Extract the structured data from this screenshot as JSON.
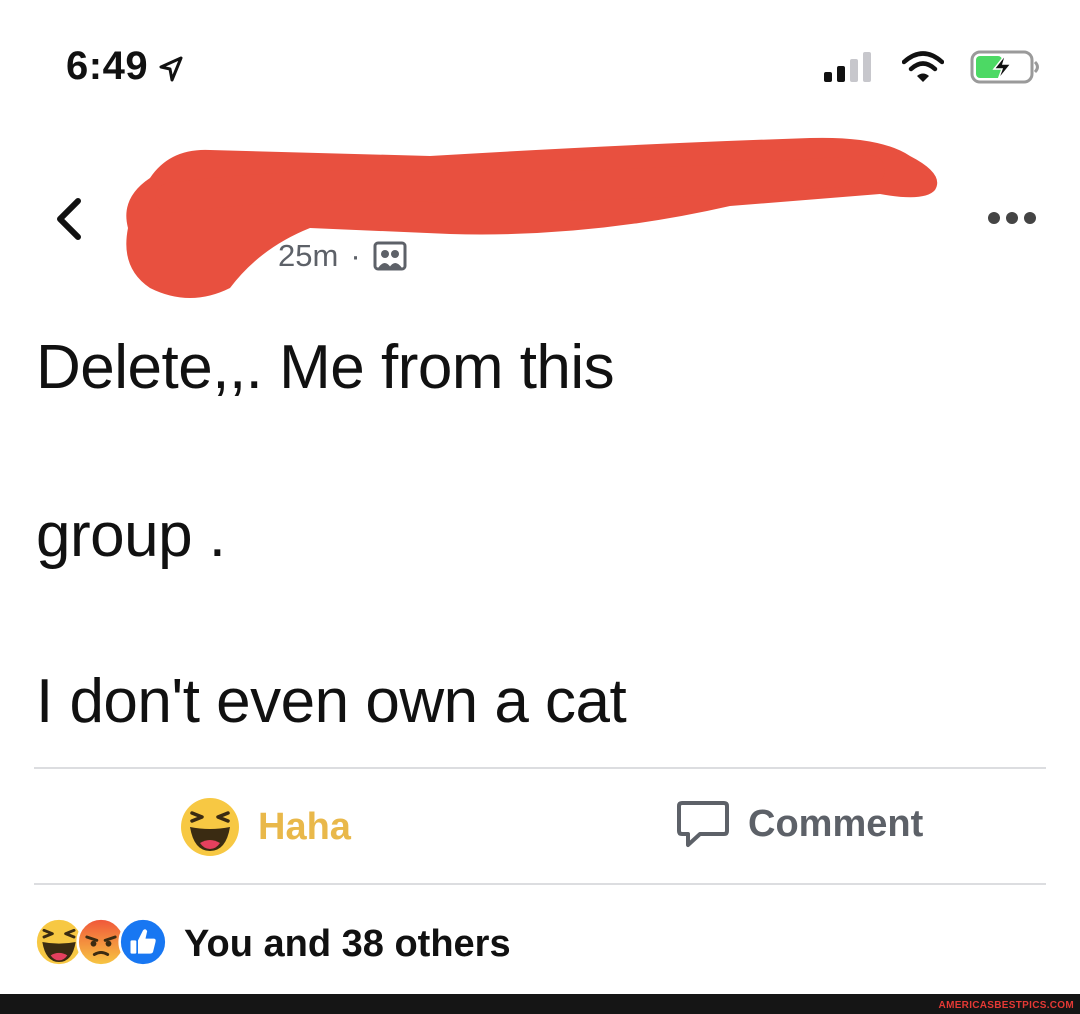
{
  "status_bar": {
    "time": "6:49",
    "icons": [
      "location-arrow-icon",
      "cellular-signal-icon",
      "wifi-icon",
      "battery-charging-icon"
    ],
    "battery_color": "#4cd964"
  },
  "header": {
    "icons": [
      "back-chevron-icon",
      "more-options-icon"
    ],
    "timestamp": "25m",
    "separator": "·",
    "audience_icon": "group-icon"
  },
  "post": {
    "lines": [
      "Delete,,. Me from this",
      "group .",
      "I don't even own a cat"
    ]
  },
  "actions": {
    "haha_label": "Haha",
    "comment_label": "Comment",
    "haha_color": "#e9b84a",
    "comment_color": "#5d6168"
  },
  "reactions": {
    "icons": [
      "haha-reaction-icon",
      "angry-reaction-icon",
      "like-reaction-icon"
    ],
    "summary": "You and 38 others"
  },
  "colors": {
    "redaction": "#e8503f",
    "divider": "#dcdde0",
    "like_blue": "#1877f2"
  },
  "watermark": "AMERICASBESTPICS.COM"
}
